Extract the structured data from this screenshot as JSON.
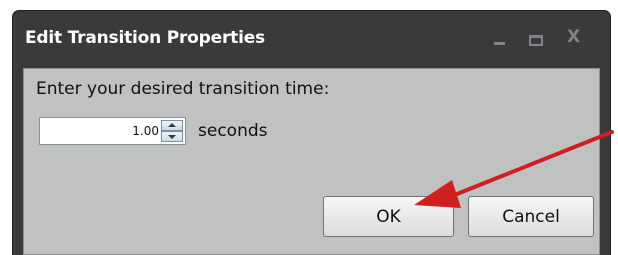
{
  "dialog": {
    "title": "Edit Transition Properties",
    "prompt": "Enter your desired transition time:",
    "time_value": "1.00",
    "unit_label": "seconds",
    "ok_label": "OK",
    "cancel_label": "Cancel"
  },
  "window_controls": {
    "minimize_icon": "minimize-icon",
    "maximize_icon": "maximize-icon",
    "close_glyph": "X"
  },
  "colors": {
    "titlebar": "#3a3a3a",
    "content_bg": "#bfc2c0",
    "annotation_arrow": "#d01f1f"
  }
}
